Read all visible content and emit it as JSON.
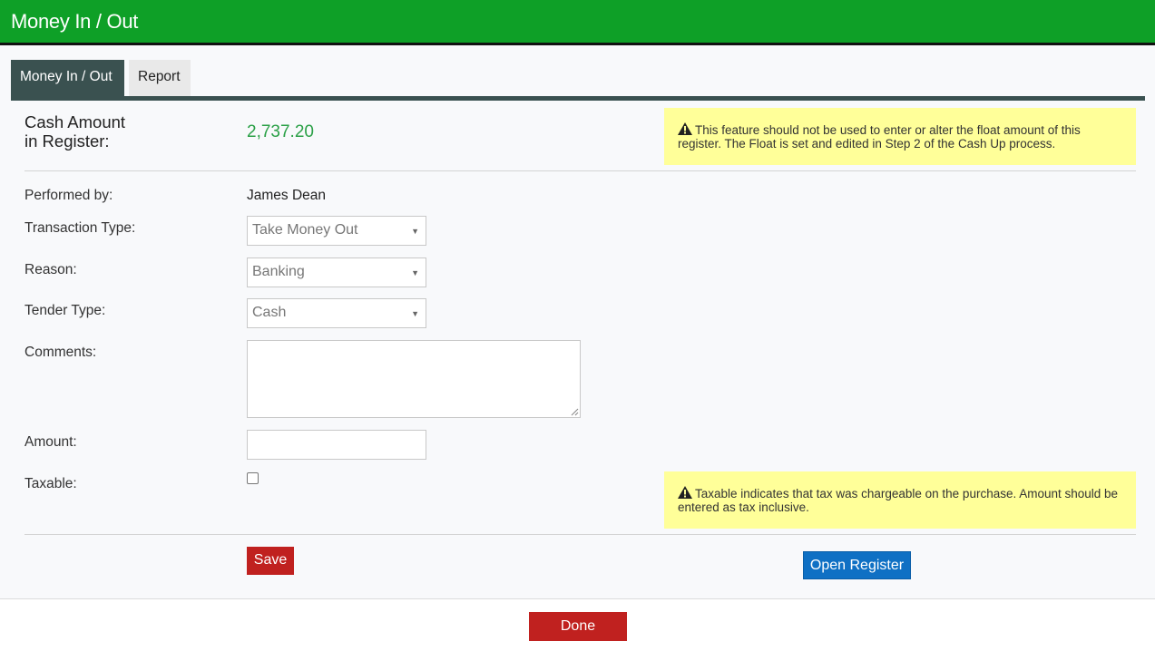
{
  "window": {
    "title": "Money In / Out"
  },
  "tabs": [
    {
      "label": "Money In / Out",
      "active": true
    },
    {
      "label": "Report",
      "active": false
    }
  ],
  "cash": {
    "label_line1": "Cash Amount",
    "label_line2": "in Register:",
    "value": "2,737.20"
  },
  "notes": {
    "float_warning": "This feature should not be used to enter or alter the float amount of this register. The Float is set and edited in Step 2 of the Cash Up process.",
    "taxable_warning": "Taxable indicates that tax was chargeable on the purchase. Amount should be entered as tax inclusive."
  },
  "form": {
    "performed_by_label": "Performed by:",
    "performed_by_value": "James Dean",
    "transaction_type_label": "Transaction Type:",
    "transaction_type_value": "Take Money Out",
    "reason_label": "Reason:",
    "reason_value": "Banking",
    "tender_type_label": "Tender Type:",
    "tender_type_value": "Cash",
    "comments_label": "Comments:",
    "comments_value": "",
    "amount_label": "Amount:",
    "amount_value": "",
    "taxable_label": "Taxable:",
    "taxable_checked": false
  },
  "buttons": {
    "save": "Save",
    "open_register": "Open Register",
    "done": "Done"
  },
  "colors": {
    "titlebar": "#0ea027",
    "tab_active": "#3a5150",
    "cash_value": "#2aa046",
    "note_bg": "#ffff99",
    "save_button": "#c0211f",
    "open_register_button": "#0f70c4",
    "done_button": "#c0211f"
  },
  "icons": [
    "warning-icon",
    "caret-down-icon",
    "resize-grip-icon"
  ]
}
